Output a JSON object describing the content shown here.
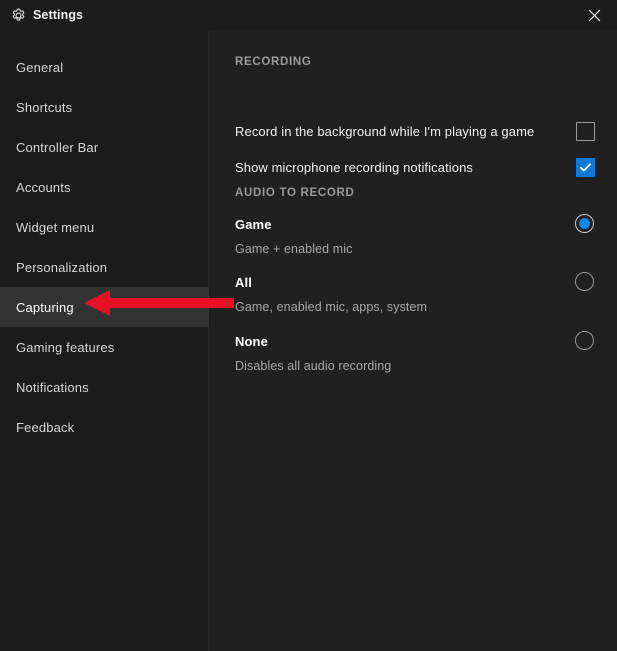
{
  "window": {
    "title": "Settings",
    "gear_icon": "gear-icon",
    "close_icon": "close-icon"
  },
  "colors": {
    "titlebar_bg": "#1c1c1c",
    "sidebar_bg": "#1b1b1b",
    "content_bg": "#202020",
    "selected_nav_bg": "#333333",
    "accent_blue": "#0f7ad6",
    "radio_blue": "#0f86e8",
    "annotation_red": "#e81123",
    "text_primary": "#f0f0f0",
    "text_secondary": "#a8a8a8",
    "section_header": "#9a9a9a"
  },
  "sidebar": {
    "items": [
      {
        "label": "General",
        "selected": false
      },
      {
        "label": "Shortcuts",
        "selected": false
      },
      {
        "label": "Controller Bar",
        "selected": false
      },
      {
        "label": "Accounts",
        "selected": false
      },
      {
        "label": "Widget menu",
        "selected": false
      },
      {
        "label": "Personalization",
        "selected": false
      },
      {
        "label": "Capturing",
        "selected": true
      },
      {
        "label": "Gaming features",
        "selected": false
      },
      {
        "label": "Notifications",
        "selected": false
      },
      {
        "label": "Feedback",
        "selected": false
      }
    ]
  },
  "content": {
    "recording": {
      "header": "RECORDING",
      "toggles": [
        {
          "label": "Record in the background while I'm playing a game",
          "checked": false
        },
        {
          "label": "Show microphone recording notifications",
          "checked": true
        }
      ]
    },
    "audio_to_record": {
      "header": "AUDIO TO RECORD",
      "options": [
        {
          "title": "Game",
          "subtitle": "Game + enabled mic",
          "selected": true
        },
        {
          "title": "All",
          "subtitle": "Game, enabled mic, apps, system",
          "selected": false
        },
        {
          "title": "None",
          "subtitle": "Disables all audio recording",
          "selected": false
        }
      ]
    }
  },
  "annotation": {
    "name": "red-left-arrow",
    "points_to": "Capturing",
    "color": "#e81123"
  }
}
